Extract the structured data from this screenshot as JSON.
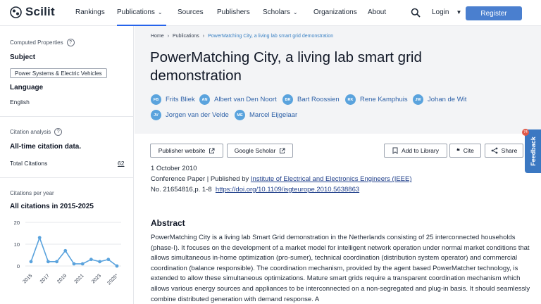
{
  "header": {
    "logo_text": "Scilit",
    "nav": [
      "Rankings",
      "Publications",
      "Sources",
      "Publishers",
      "Scholars",
      "Organizations",
      "About"
    ],
    "login": "Login",
    "register": "Register"
  },
  "sidebar": {
    "computed_title": "Computed Properties",
    "subject_label": "Subject",
    "subject_tag": "Power Systems & Electric Vehicles",
    "language_label": "Language",
    "language_value": "English",
    "citation_title": "Citation analysis",
    "citation_heading": "All-time citation data.",
    "total_label": "Total Citations",
    "total_value": "62",
    "per_year_title": "Citations per year",
    "per_year_heading": "All citations in 2015-2025"
  },
  "chart_data": {
    "type": "line",
    "x": [
      "2015",
      "2016",
      "2017",
      "2018",
      "2019",
      "2020",
      "2021",
      "2022",
      "2023",
      "2024",
      "2025*"
    ],
    "tick_labels": [
      "2015",
      "2017",
      "2019",
      "2021",
      "2023",
      "2025*"
    ],
    "values": [
      2,
      13,
      2,
      2,
      7,
      1,
      1,
      3,
      2,
      3,
      0
    ],
    "y_ticks": [
      "20",
      "10",
      "0"
    ],
    "ylim": [
      0,
      20
    ],
    "colors": {
      "line": "#5aa3dd",
      "grid": "#e5e7eb"
    }
  },
  "main": {
    "breadcrumb": [
      "Home",
      "Publications",
      "PowerMatching City, a living lab smart grid demonstration"
    ],
    "title": "PowerMatching City, a living lab smart grid demonstration",
    "authors": [
      {
        "initials": "FB",
        "name": "Frits Bliek"
      },
      {
        "initials": "AN",
        "name": "Albert van Den Noort"
      },
      {
        "initials": "BR",
        "name": "Bart Roossien"
      },
      {
        "initials": "RK",
        "name": "Rene Kamphuis"
      },
      {
        "initials": "JW",
        "name": "Johan de Wit"
      },
      {
        "initials": "JV",
        "name": "Jorgen van der Velde"
      },
      {
        "initials": "ME",
        "name": "Marcel Eijgelaar"
      }
    ],
    "buttons": {
      "publisher_website": "Publisher website",
      "google_scholar": "Google Scholar",
      "add_to_library": "Add to Library",
      "cite": "Cite",
      "share": "Share"
    },
    "date": "1 October 2010",
    "pub_prefix": "Conference Paper | Published by ",
    "publisher": "Institute of Electrical and Electronics Engineers (IEEE)",
    "number": "No. 21654816,p. 1-8",
    "doi": "https://doi.org/10.1109/isgteurope.2010.5638863",
    "abstract_title": "Abstract",
    "abstract_text": "PowerMatching City is a living lab Smart Grid demonstration in the Netherlands consisting of 25 interconnected households (phase-I). It focuses on the development of a market model for intelligent network operation under normal market conditions that allows simultaneous in-home optimization (pro-sumer), technical coordination (distribution system operator) and commercial coordination (balance responsible). The coordination mechanism, provided by the agent based PowerMatcher technology, is extended to allow these simultaneous optimizations. Mature smart grids require a transparent coordination mechanism which allows various energy sources and appliances to be interconnected on a non-segregated and plug-in basis. It should seamlessly combine distributed generation with demand response. A"
  },
  "feedback": {
    "label": "Feedback",
    "badge": "74"
  }
}
